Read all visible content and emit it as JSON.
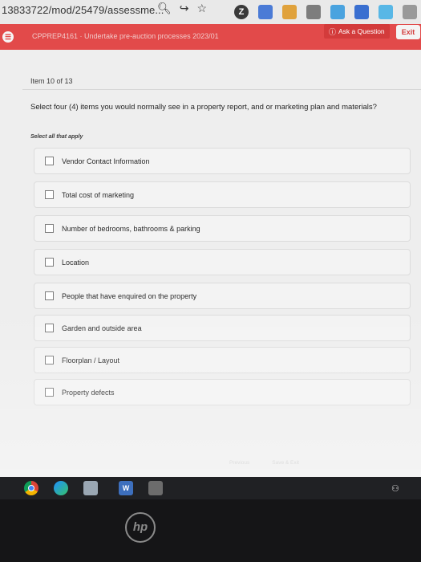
{
  "browser": {
    "url": "13833722/mod/25479/assessme...",
    "icons": [
      "search-icon",
      "share-icon",
      "star-icon"
    ],
    "extension_badge": "Z"
  },
  "app_header": {
    "course_title": "CPPREP4161 · Undertake pre-auction processes 2023/01",
    "ask_label": "Ask a Question",
    "exit_label": "Exit"
  },
  "question": {
    "item_counter": "Item 10 of 13",
    "text": "Select four (4) items you would normally see in a property report, and or marketing plan and materials?",
    "instruction": "Select all that apply",
    "options": [
      {
        "label": "Vendor Contact Information",
        "checked": false
      },
      {
        "label": "Total cost of marketing",
        "checked": false
      },
      {
        "label": "Number of bedrooms, bathrooms & parking",
        "checked": false
      },
      {
        "label": "Location",
        "checked": false
      },
      {
        "label": "People that have enquired on the property",
        "checked": false
      },
      {
        "label": "Garden and outside area",
        "checked": false
      },
      {
        "label": "Floorplan / Layout",
        "checked": false
      },
      {
        "label": "Property defects",
        "checked": false
      }
    ]
  },
  "footer": {
    "previous_label": "Previous",
    "save_label": "Save & Exit"
  },
  "taskbar": {
    "apps": [
      "chrome-icon",
      "edge-icon",
      "files-icon",
      "word-icon",
      "calculator-icon"
    ],
    "word_letter": "W"
  },
  "device": {
    "logo_text": "hp"
  },
  "colors": {
    "header_red": "#e24a4a",
    "page_bg": "#eeeeee"
  }
}
